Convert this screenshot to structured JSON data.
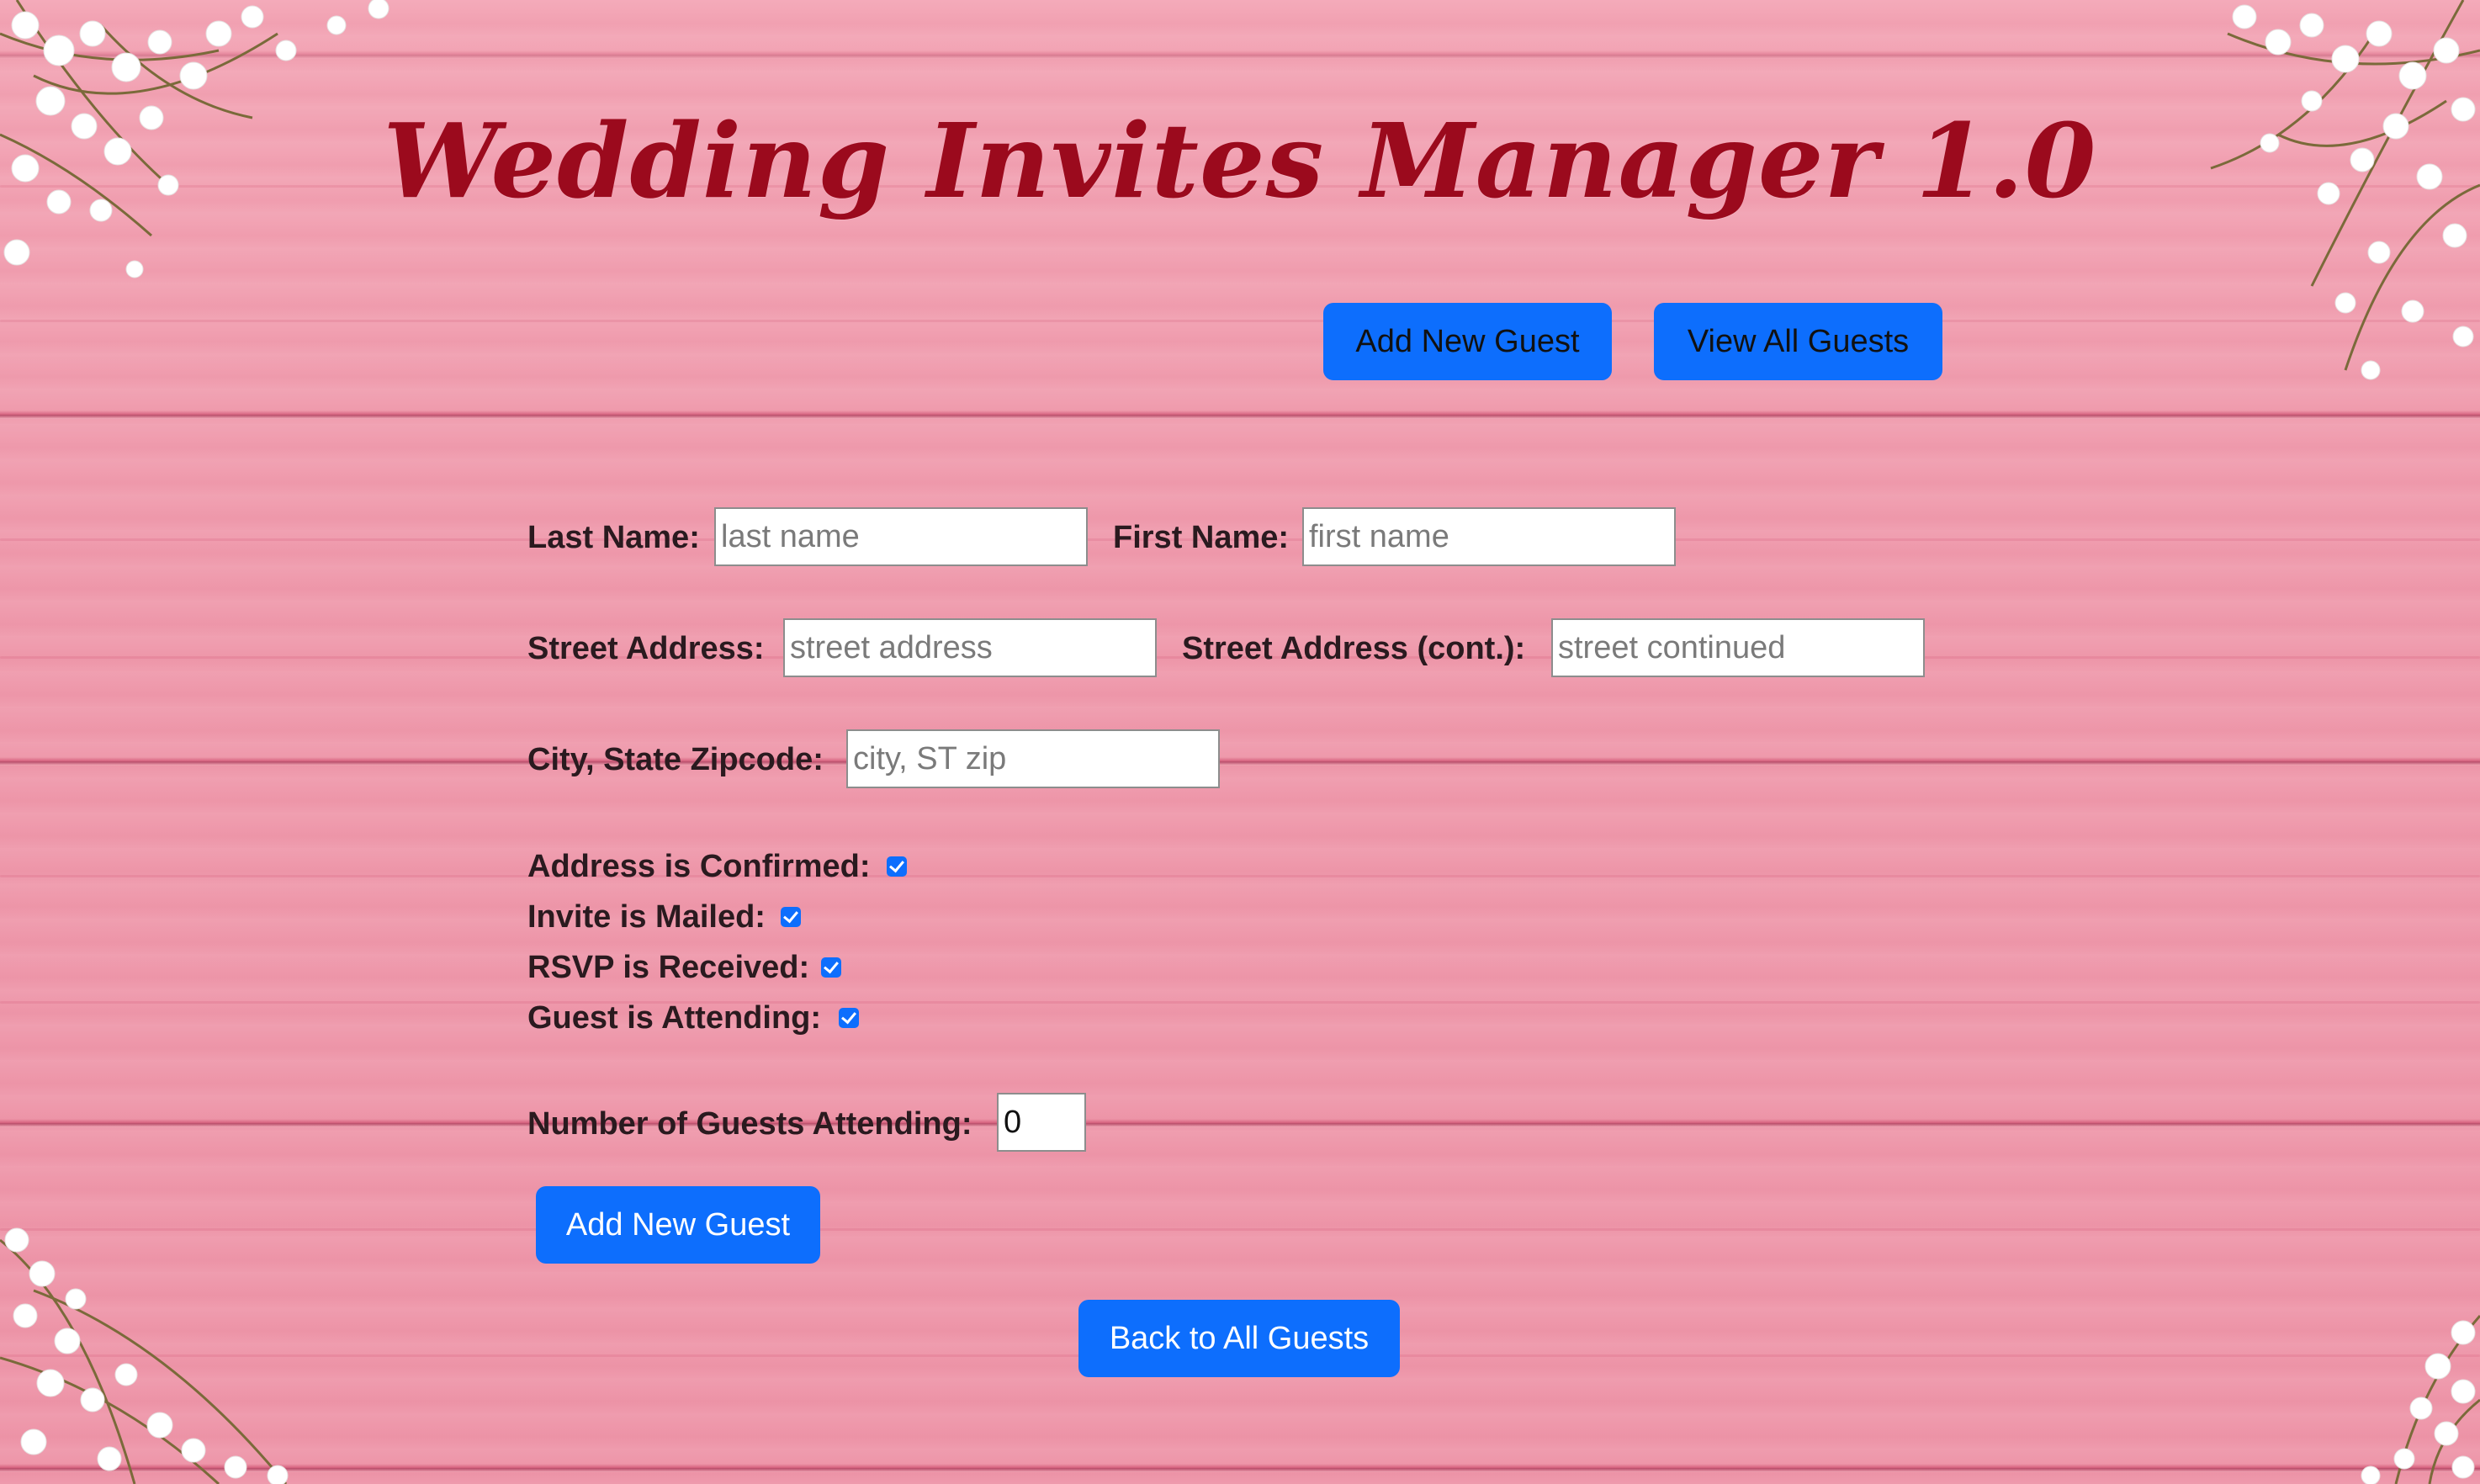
{
  "header": {
    "title": "Wedding Invites Manager 1.0",
    "nav": {
      "add_guest_label": "Add New Guest",
      "view_all_label": "View All Guests"
    }
  },
  "form": {
    "last_name": {
      "label": "Last Name:",
      "value": "",
      "placeholder": "last name"
    },
    "first_name": {
      "label": "First Name:",
      "value": "",
      "placeholder": "first name"
    },
    "street_address": {
      "label": "Street Address:",
      "value": "",
      "placeholder": "street address"
    },
    "street_address_cont": {
      "label": "Street Address (cont.):",
      "value": "",
      "placeholder": "street continued"
    },
    "city_state_zip": {
      "label": "City, State Zipcode:",
      "value": "",
      "placeholder": "city, ST zip"
    },
    "checkboxes": [
      {
        "label": "Address is Confirmed:",
        "checked": true
      },
      {
        "label": "Invite is Mailed:",
        "checked": true
      },
      {
        "label": "RSVP is Received:",
        "checked": true
      },
      {
        "label": "Guest is Attending:",
        "checked": true
      }
    ],
    "num_guests": {
      "label": "Number of Guests Attending:",
      "value": "0"
    },
    "submit_label": "Add New Guest"
  },
  "footer": {
    "back_label": "Back to All Guests"
  },
  "colors": {
    "accent": "#0d6efd",
    "title": "#9b0a1d",
    "background": "#ef9aab"
  },
  "icons": [
    "checkbox-checked-icon",
    "baby-breath-flowers-decoration"
  ]
}
